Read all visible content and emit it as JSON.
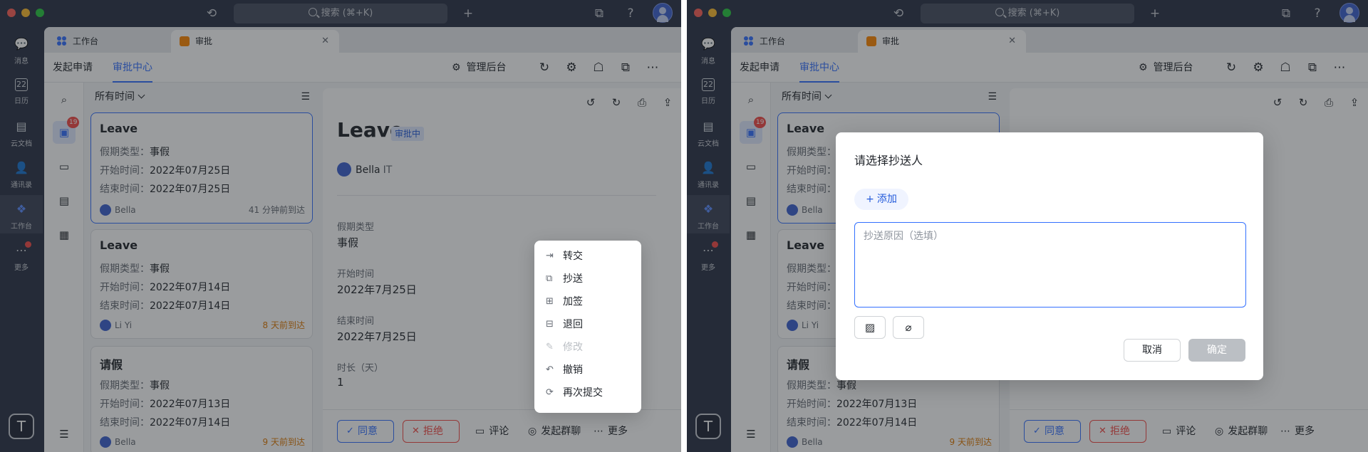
{
  "titlebar": {
    "search_placeholder": "搜索 (⌘+K)"
  },
  "rail": {
    "items": [
      {
        "label": "消息",
        "icon": "message-icon"
      },
      {
        "label": "日历",
        "icon": "calendar-icon",
        "day": "22"
      },
      {
        "label": "云文档",
        "icon": "docs-icon"
      },
      {
        "label": "通讯录",
        "icon": "contacts-icon"
      },
      {
        "label": "工作台",
        "icon": "workplace-icon"
      },
      {
        "label": "更多",
        "icon": "more-icon"
      }
    ],
    "bottom_avatar_letter": "T"
  },
  "tabs": [
    {
      "label": "工作台"
    },
    {
      "label": "审批"
    }
  ],
  "subheader": {
    "tab_submit": "发起申请",
    "tab_center": "审批中心",
    "admin": "管理后台"
  },
  "list": {
    "filter": "所有时间",
    "badge": "19",
    "cards": [
      {
        "title": "Leave",
        "type_label": "假期类型：",
        "type": "事假",
        "start_label": "开始时间：",
        "start": "2022年07月25日",
        "end_label": "结束时间：",
        "end": "2022年07月25日",
        "user": "Bella",
        "when": "41 分钟前到达"
      },
      {
        "title": "Leave",
        "type_label": "假期类型：",
        "type": "事假",
        "start_label": "开始时间：",
        "start": "2022年07月14日",
        "end_label": "结束时间：",
        "end": "2022年07月14日",
        "user": "Li Yi",
        "when": "8 天前到达"
      },
      {
        "title": "请假",
        "type_label": "假期类型：",
        "type": "事假",
        "start_label": "开始时间：",
        "start": "2022年07月13日",
        "end_label": "结束时间：",
        "end": "2022年07月14日",
        "user": "Bella",
        "when": "9 天前到达"
      }
    ]
  },
  "detail": {
    "title": "Leave",
    "status": "审批中",
    "user": "Bella",
    "dept": "IT",
    "fields": [
      {
        "label": "假期类型",
        "value": "事假"
      },
      {
        "label": "开始时间",
        "value": "2022年7月25日"
      },
      {
        "label": "结束时间",
        "value": "2022年7月25日"
      },
      {
        "label": "时长（天）",
        "value": "1"
      }
    ],
    "actions": {
      "approve": "同意",
      "reject": "拒绝",
      "comment": "评论",
      "group_chat": "发起群聊",
      "more": "更多"
    }
  },
  "menu": {
    "items": [
      "转交",
      "抄送",
      "加签",
      "退回",
      "修改",
      "撤销",
      "再次提交"
    ]
  },
  "dialog": {
    "title": "请选择抄送人",
    "add": "添加",
    "reason_placeholder": "抄送原因（选填）",
    "cancel": "取消",
    "confirm": "确定"
  },
  "colors": {
    "accent": "#3370ff",
    "danger": "#f54a45",
    "warn": "#de7802",
    "rail": "#2b3245"
  }
}
